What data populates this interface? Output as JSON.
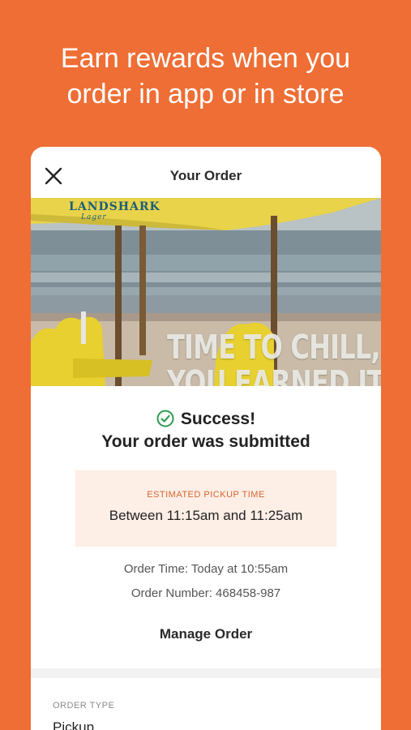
{
  "headline": {
    "line1": "Earn rewards when you",
    "line2": "order in app or in store"
  },
  "header": {
    "title": "Your Order",
    "close_icon": "close-icon"
  },
  "hero": {
    "brand": "LANDSHARK",
    "brand_sub": "Lager",
    "line1": "TIME TO CHILL,",
    "line2": "YOU EARNED IT!"
  },
  "status": {
    "icon": "check-circle-icon",
    "title": "Success!",
    "message": "Your order was submitted"
  },
  "pickup": {
    "label": "ESTIMATED PICKUP TIME",
    "window": "Between 11:15am and 11:25am"
  },
  "order": {
    "time": "Order Time: Today at 10:55am",
    "number": "Order Number: 468458-987",
    "manage_label": "Manage Order",
    "type_label": "ORDER TYPE",
    "type_value": "Pickup"
  },
  "colors": {
    "background": "#EE6E35",
    "accent": "#D4662F",
    "success": "#2E9B4F",
    "pickup_bg": "#FDEEE6"
  }
}
